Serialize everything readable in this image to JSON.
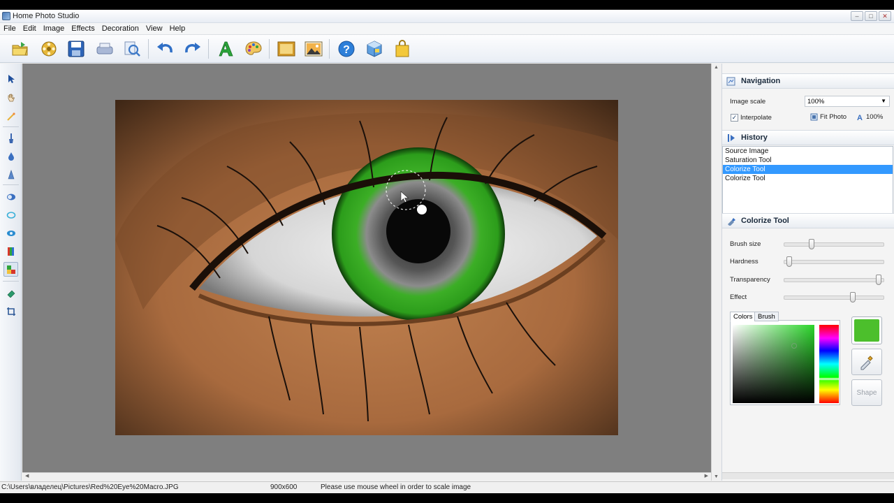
{
  "window": {
    "title": "Home Photo Studio",
    "buttons": [
      "–",
      "□",
      "✕"
    ]
  },
  "menu": [
    "File",
    "Edit",
    "Image",
    "Effects",
    "Decoration",
    "View",
    "Help"
  ],
  "toolbar": {
    "icons": [
      "open-folder-icon",
      "film-reel-icon",
      "save-disk-icon",
      "print-icon",
      "print-preview-icon",
      "undo-icon",
      "redo-icon",
      "text-A-icon",
      "palette-icon",
      "image-frame-icon",
      "photo-landscape-icon",
      "help-icon",
      "cube-icon",
      "shopping-bag-icon"
    ]
  },
  "left_tools": [
    "pointer-icon",
    "hand-icon",
    "magic-wand-icon",
    "brush-icon",
    "drop-icon",
    "cone-icon",
    "lens-icon",
    "drop-outline-icon",
    "eye-icon",
    "levels-icon",
    "colorize-icon",
    "eraser-icon",
    "crop-icon"
  ],
  "navigation": {
    "title": "Navigation",
    "image_scale_label": "Image scale",
    "image_scale_value": "100%",
    "interpolate_label": "Interpolate",
    "interpolate_checked": true,
    "fit_photo_label": "Fit Photo",
    "zoom_100_label": "100%"
  },
  "history": {
    "title": "History",
    "items": [
      "Source Image",
      "Saturation Tool",
      "Colorize Tool",
      "Colorize Tool"
    ],
    "selected_index": 2
  },
  "colorize_tool": {
    "title": "Colorize Tool",
    "brush_size_label": "Brush size",
    "hardness_label": "Hardness",
    "transparency_label": "Transparency",
    "effect_label": "Effect",
    "brush_size": 0.26,
    "hardness": 0.02,
    "transparency": 0.98,
    "effect": 0.7,
    "tabs": [
      "Colors",
      "Brush"
    ],
    "active_tab": "Colors",
    "current_color": "#4cbf2c",
    "shape_label": "Shape"
  },
  "status": {
    "path": "C:\\Users\\владелец\\Pictures\\Red%20Eye%20Macro.JPG",
    "size": "900x600",
    "hint": "Please use mouse wheel in order to scale image"
  }
}
